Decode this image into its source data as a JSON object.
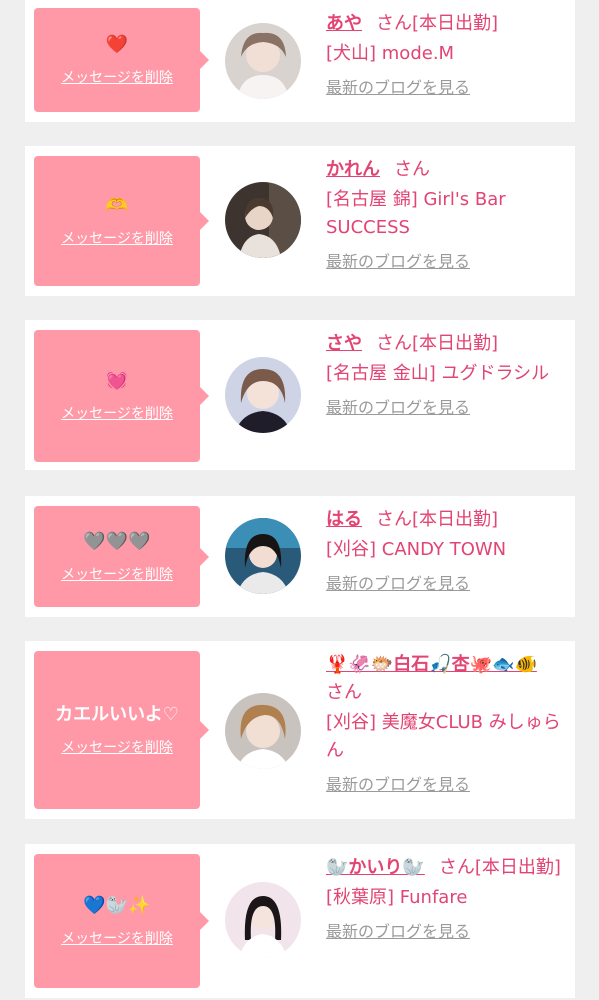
{
  "delete_label": "メッセージを削除",
  "san_label": "さん",
  "blog_label": "最新のブログを見る",
  "today_label": "[本日出勤]",
  "colors": {
    "accent": "#e24474",
    "bubble": "#ff99a8",
    "background": "#efefef"
  },
  "entries": [
    {
      "message": "❤️",
      "name": "あや",
      "working_today": true,
      "shop": "[犬山] mode.M"
    },
    {
      "message": "🫶",
      "name": "かれん",
      "working_today": false,
      "shop": "[名古屋 錦] Girl's Bar SUCCESS"
    },
    {
      "message": "💓",
      "name": "さや",
      "working_today": true,
      "shop": "[名古屋 金山] ユグドラシル"
    },
    {
      "message": "🩶🩶🩶",
      "name": "はる",
      "working_today": true,
      "shop": "[刈谷] CANDY TOWN"
    },
    {
      "message": "カエルいいよ♡",
      "name": "🦞🦑🐡白石🎣杏🐙🐟🐠",
      "working_today": false,
      "shop": "[刈谷] 美魔女CLUB みしゅらん"
    },
    {
      "message": "💙🦭✨",
      "name": "🦭かいり🦭",
      "working_today": true,
      "shop": "[秋葉原] Funfare"
    }
  ]
}
